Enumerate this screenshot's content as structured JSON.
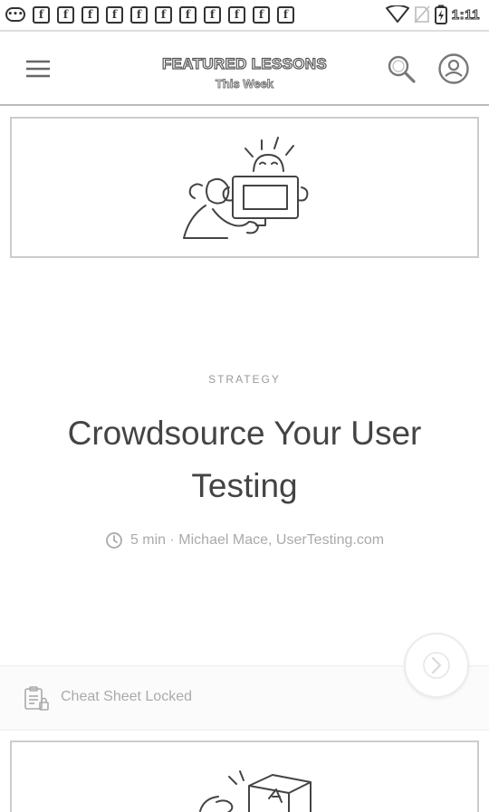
{
  "status_bar": {
    "notification_icons": [
      "f",
      "f",
      "f",
      "f",
      "f",
      "f",
      "f",
      "f",
      "f",
      "f",
      "f"
    ],
    "time": "1:11"
  },
  "header": {
    "title": "FEATURED LESSONS",
    "subtitle": "This Week"
  },
  "lesson": {
    "category": "STRATEGY",
    "title": "Crowdsource Your User Testing",
    "meta": "5 min · Michael Mace, UserTesting.com"
  },
  "cheat_sheet": {
    "label": "Cheat Sheet Locked"
  },
  "icons": {
    "menu": "hamburger-icon",
    "search": "search-icon",
    "profile": "profile-icon",
    "clock": "clock-icon",
    "next": "chevron-right-icon",
    "cheat_sheet": "locked-document-icon"
  }
}
